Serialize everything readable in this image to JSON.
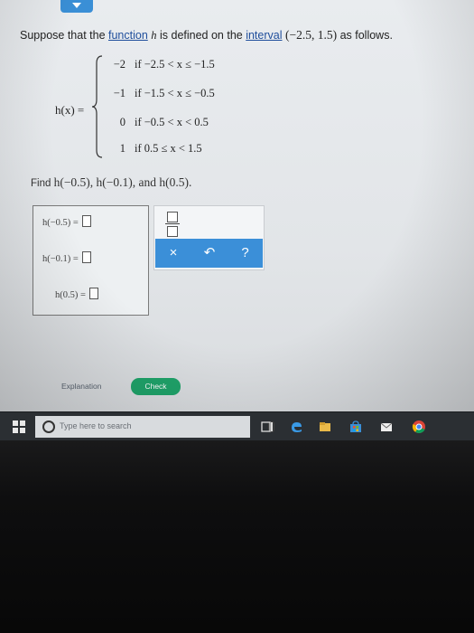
{
  "question": {
    "prefix": "Suppose that the ",
    "link_function": "function",
    "mid1": " ",
    "var_h": "h",
    "mid2": " is defined on the ",
    "link_interval": "interval",
    "interval_value": "(−2.5, 1.5)",
    "suffix": " as follows."
  },
  "piecewise": {
    "lhs": "h(x) =",
    "cases": [
      {
        "value": "−2",
        "condition": "if −2.5 < x ≤ −1.5"
      },
      {
        "value": "−1",
        "condition": "if −1.5 < x ≤ −0.5"
      },
      {
        "value": "0",
        "condition": "if −0.5 < x < 0.5"
      },
      {
        "value": "1",
        "condition": "if 0.5 ≤ x < 1.5"
      }
    ]
  },
  "find": {
    "label": "Find ",
    "expr": "h(−0.5), h(−0.1), and h(0.5)."
  },
  "answers": [
    {
      "label": "h(−0.5) ="
    },
    {
      "label": "h(−0.1) ="
    },
    {
      "label": "h(0.5) ="
    }
  ],
  "tools": {
    "clear_label": "×",
    "undo_label": "↶",
    "help_label": "?"
  },
  "footer": {
    "explanation_label": "Explanation",
    "check_label": "Check"
  },
  "taskbar": {
    "search_placeholder": "Type here to search",
    "icons": [
      "windows-start-icon",
      "microphone-icon",
      "task-view-icon",
      "edge-icon",
      "file-explorer-icon",
      "store-icon",
      "mail-icon",
      "chrome-icon"
    ]
  },
  "colors": {
    "accent_blue": "#3b8fd8",
    "check_green": "#1fa36a",
    "taskbar": "#2b2f33"
  }
}
